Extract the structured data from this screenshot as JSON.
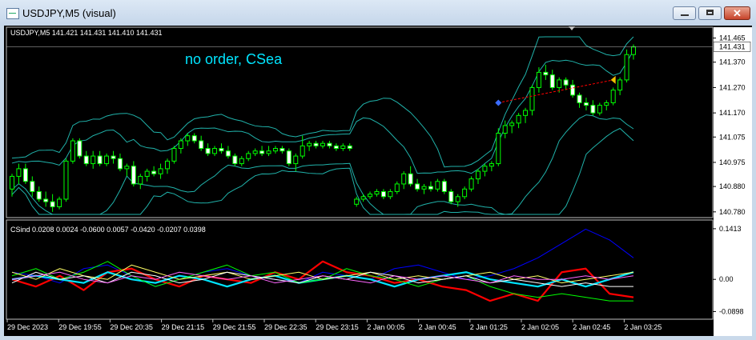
{
  "window": {
    "title": "USDJPY,M5 (visual)",
    "min_label": "",
    "max_label": "",
    "close_label": "✕"
  },
  "colors": {
    "background": "#000000",
    "candle": "#00ff00",
    "grid_border": "#c0c0c0",
    "comment": "#00e5ff",
    "bands": "#20b2aa",
    "text": "#ffffff"
  },
  "chart_data": [
    {
      "type": "candlestick",
      "symbol": "USDJPY,M5",
      "info": "USDJPY,M5  141.421 141.431 141.410 141.431",
      "comment": "no order, CSea",
      "y_ticks": [
        "141.465",
        "141.370",
        "141.270",
        "141.170",
        "141.075",
        "140.975",
        "140.880",
        "140.780"
      ],
      "ylim": [
        140.77,
        141.47
      ],
      "current_price": "141.431",
      "indicators": [
        "Bollinger Bands (20)",
        "Bollinger Bands (wide)"
      ],
      "ohlc": [
        [
          140.87,
          140.93,
          140.84,
          140.92
        ],
        [
          140.92,
          140.97,
          140.89,
          140.95
        ],
        [
          140.95,
          140.97,
          140.89,
          140.9
        ],
        [
          140.9,
          140.92,
          140.84,
          140.86
        ],
        [
          140.86,
          140.88,
          140.82,
          140.83
        ],
        [
          140.83,
          140.86,
          140.8,
          140.82
        ],
        [
          140.82,
          140.85,
          140.78,
          140.8
        ],
        [
          140.8,
          140.84,
          140.79,
          140.83
        ],
        [
          140.83,
          140.99,
          140.82,
          140.98
        ],
        [
          140.98,
          141.07,
          140.97,
          141.06
        ],
        [
          141.06,
          141.07,
          140.99,
          141.0
        ],
        [
          141.0,
          141.02,
          140.96,
          140.97
        ],
        [
          140.97,
          141.02,
          140.95,
          141.0
        ],
        [
          141.0,
          141.02,
          140.96,
          140.97
        ],
        [
          140.97,
          141.01,
          140.96,
          141.0
        ],
        [
          141.0,
          141.02,
          140.97,
          140.99
        ],
        [
          140.99,
          141.01,
          140.94,
          140.95
        ],
        [
          140.95,
          140.97,
          140.92,
          140.96
        ],
        [
          140.96,
          140.98,
          140.88,
          140.89
        ],
        [
          140.89,
          140.93,
          140.87,
          140.92
        ],
        [
          140.92,
          140.95,
          140.9,
          140.94
        ],
        [
          140.94,
          140.96,
          140.92,
          140.93
        ],
        [
          140.93,
          140.97,
          140.91,
          140.95
        ],
        [
          140.95,
          140.99,
          140.93,
          140.98
        ],
        [
          140.98,
          141.04,
          140.97,
          141.03
        ],
        [
          141.03,
          141.07,
          141.01,
          141.06
        ],
        [
          141.06,
          141.09,
          141.04,
          141.08
        ],
        [
          141.08,
          141.09,
          141.05,
          141.06
        ],
        [
          141.06,
          141.08,
          141.02,
          141.03
        ],
        [
          141.03,
          141.05,
          141.0,
          141.01
        ],
        [
          141.01,
          141.04,
          141.0,
          141.03
        ],
        [
          141.03,
          141.05,
          141.01,
          141.02
        ],
        [
          141.02,
          141.04,
          140.99,
          141.0
        ],
        [
          141.0,
          141.01,
          140.96,
          140.97
        ],
        [
          140.97,
          141.0,
          140.96,
          140.99
        ],
        [
          140.99,
          141.02,
          140.98,
          141.01
        ],
        [
          141.01,
          141.03,
          141.0,
          141.02
        ],
        [
          141.02,
          141.04,
          141.0,
          141.01
        ],
        [
          141.01,
          141.04,
          141.0,
          141.02
        ],
        [
          141.02,
          141.04,
          141.01,
          141.03
        ],
        [
          141.03,
          141.04,
          141.01,
          141.02
        ],
        [
          141.02,
          141.03,
          140.96,
          140.97
        ],
        [
          140.97,
          141.01,
          140.94,
          141.0
        ],
        [
          141.0,
          141.08,
          140.99,
          141.04
        ],
        [
          141.04,
          141.06,
          141.02,
          141.05
        ],
        [
          141.05,
          141.06,
          141.03,
          141.04
        ],
        [
          141.04,
          141.06,
          141.03,
          141.05
        ],
        [
          141.05,
          141.06,
          141.03,
          141.04
        ],
        [
          141.04,
          141.05,
          141.02,
          141.03
        ],
        [
          141.03,
          141.05,
          141.02,
          141.04
        ],
        [
          141.04,
          141.05,
          141.02,
          141.03
        ],
        [
          140.81,
          140.84,
          140.8,
          140.83
        ],
        [
          140.83,
          140.85,
          140.82,
          140.84
        ],
        [
          140.84,
          140.86,
          140.83,
          140.85
        ],
        [
          140.85,
          140.87,
          140.84,
          140.86
        ],
        [
          140.86,
          140.87,
          140.83,
          140.84
        ],
        [
          140.84,
          140.87,
          140.83,
          140.86
        ],
        [
          140.86,
          140.9,
          140.85,
          140.89
        ],
        [
          140.89,
          140.94,
          140.87,
          140.93
        ],
        [
          140.93,
          140.96,
          140.88,
          140.89
        ],
        [
          140.89,
          140.91,
          140.86,
          140.87
        ],
        [
          140.87,
          140.89,
          140.85,
          140.88
        ],
        [
          140.88,
          140.9,
          140.86,
          140.87
        ],
        [
          140.87,
          140.91,
          140.86,
          140.9
        ],
        [
          140.9,
          140.91,
          140.85,
          140.86
        ],
        [
          140.86,
          140.87,
          140.81,
          140.82
        ],
        [
          140.82,
          140.85,
          140.8,
          140.84
        ],
        [
          140.84,
          140.88,
          140.83,
          140.87
        ],
        [
          140.87,
          140.92,
          140.86,
          140.91
        ],
        [
          140.91,
          140.95,
          140.89,
          140.94
        ],
        [
          140.94,
          140.97,
          140.92,
          140.96
        ],
        [
          140.96,
          140.98,
          140.94,
          140.97
        ],
        [
          140.97,
          141.11,
          140.96,
          141.09
        ],
        [
          141.09,
          141.14,
          141.07,
          141.12
        ],
        [
          141.12,
          141.14,
          141.09,
          141.13
        ],
        [
          141.13,
          141.17,
          141.11,
          141.16
        ],
        [
          141.16,
          141.19,
          141.13,
          141.18
        ],
        [
          141.18,
          141.28,
          141.16,
          141.27
        ],
        [
          141.27,
          141.35,
          141.25,
          141.33
        ],
        [
          141.33,
          141.36,
          141.3,
          141.32
        ],
        [
          141.32,
          141.34,
          141.26,
          141.27
        ],
        [
          141.27,
          141.31,
          141.25,
          141.3
        ],
        [
          141.3,
          141.31,
          141.26,
          141.28
        ],
        [
          141.28,
          141.3,
          141.23,
          141.24
        ],
        [
          141.24,
          141.25,
          141.19,
          141.21
        ],
        [
          141.21,
          141.23,
          141.18,
          141.2
        ],
        [
          141.2,
          141.22,
          141.16,
          141.17
        ],
        [
          141.17,
          141.21,
          141.16,
          141.2
        ],
        [
          141.2,
          141.22,
          141.18,
          141.21
        ],
        [
          141.21,
          141.27,
          141.2,
          141.26
        ],
        [
          141.26,
          141.31,
          141.24,
          141.3
        ],
        [
          141.3,
          141.42,
          141.29,
          141.4
        ],
        [
          141.4,
          141.44,
          141.38,
          141.43
        ]
      ]
    },
    {
      "type": "line",
      "title": "CSind 0.0208 0.0024 -0.0600 0.0057 -0.0420 -0.0207 0.0398",
      "y_ticks": [
        "0.1413",
        "0.00",
        "-0.0898"
      ],
      "ylim": [
        -0.1,
        0.15
      ],
      "x_ticks": [
        "29 Dec 2023",
        "29 Dec 19:55",
        "29 Dec 20:35",
        "29 Dec 21:15",
        "29 Dec 21:55",
        "29 Dec 22:35",
        "29 Dec 23:15",
        "2 Jan 00:05",
        "2 Jan 00:45",
        "2 Jan 01:25",
        "2 Jan 02:05",
        "2 Jan 02:45",
        "2 Jan 03:25"
      ],
      "series": [
        {
          "color": "#0000ff",
          "values": [
            0.02,
            0.01,
            -0.01,
            0.03,
            0.04,
            0.01,
            -0.02,
            0.0,
            0.02,
            0.03,
            0.01,
            0.0,
            -0.01,
            0.02,
            0.01,
            0.0,
            0.03,
            0.04,
            0.02,
            0.0,
            0.01,
            0.03,
            0.06,
            0.1,
            0.14,
            0.11,
            0.06
          ]
        },
        {
          "color": "#ff0000",
          "values": [
            0.0,
            -0.02,
            0.01,
            -0.03,
            0.02,
            0.03,
            0.0,
            -0.02,
            0.01,
            0.0,
            -0.01,
            0.02,
            0.0,
            0.05,
            0.02,
            0.01,
            -0.01,
            0.0,
            -0.02,
            -0.03,
            -0.06,
            -0.04,
            -0.06,
            0.02,
            0.03,
            -0.04,
            -0.05
          ]
        },
        {
          "color": "#00e5ff",
          "values": [
            0.0,
            0.01,
            0.0,
            -0.01,
            0.02,
            0.0,
            -0.01,
            0.01,
            0.0,
            -0.02,
            0.0,
            0.01,
            -0.01,
            0.0,
            0.01,
            0.0,
            -0.02,
            0.0,
            0.01,
            0.02,
            0.0,
            -0.01,
            -0.02,
            0.0,
            -0.02,
            0.0,
            0.02
          ]
        },
        {
          "color": "#00ff00",
          "values": [
            0.01,
            0.03,
            0.0,
            0.02,
            0.05,
            0.01,
            -0.02,
            0.0,
            0.02,
            0.04,
            0.01,
            0.02,
            -0.01,
            0.0,
            0.03,
            0.01,
            0.0,
            -0.02,
            0.0,
            0.01,
            -0.02,
            -0.04,
            -0.05,
            -0.04,
            -0.05,
            -0.06,
            -0.06
          ]
        },
        {
          "color": "#ffff66",
          "values": [
            0.02,
            0.0,
            0.03,
            0.01,
            0.0,
            0.04,
            0.02,
            0.0,
            0.01,
            0.02,
            0.0,
            0.01,
            0.02,
            0.0,
            0.01,
            0.02,
            0.0,
            0.01,
            0.0,
            0.01,
            0.02,
            0.0,
            0.01,
            -0.01,
            0.0,
            0.01,
            0.02
          ]
        },
        {
          "color": "#ffffff",
          "values": [
            -0.01,
            0.02,
            0.0,
            0.01,
            -0.01,
            0.02,
            0.01,
            -0.01,
            0.0,
            0.02,
            0.01,
            0.0,
            -0.01,
            0.01,
            0.0,
            0.02,
            0.01,
            -0.01,
            0.0,
            0.01,
            -0.01,
            0.0,
            -0.01,
            -0.02,
            -0.01,
            -0.02,
            -0.02
          ]
        },
        {
          "color": "#ff66ff",
          "values": [
            0.0,
            0.01,
            0.02,
            0.0,
            -0.01,
            0.01,
            0.0,
            0.02,
            0.01,
            0.0,
            0.01,
            -0.01,
            0.0,
            0.01,
            0.0,
            -0.01,
            0.01,
            0.0,
            0.01,
            0.0,
            -0.01,
            0.01,
            0.0,
            0.0,
            0.01,
            0.0,
            0.01
          ]
        }
      ]
    }
  ]
}
